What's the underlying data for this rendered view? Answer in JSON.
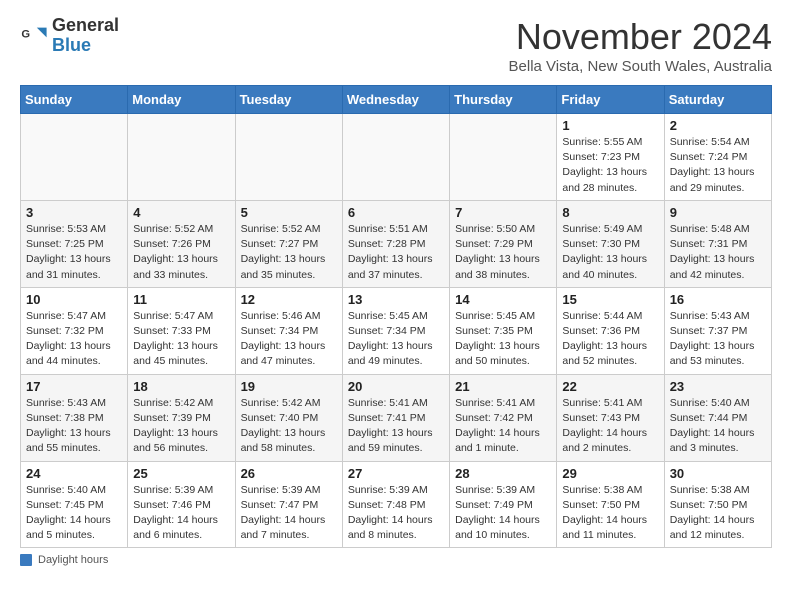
{
  "header": {
    "logo_general": "General",
    "logo_blue": "Blue",
    "month_title": "November 2024",
    "subtitle": "Bella Vista, New South Wales, Australia"
  },
  "days_of_week": [
    "Sunday",
    "Monday",
    "Tuesday",
    "Wednesday",
    "Thursday",
    "Friday",
    "Saturday"
  ],
  "weeks": [
    [
      {
        "day": "",
        "info": ""
      },
      {
        "day": "",
        "info": ""
      },
      {
        "day": "",
        "info": ""
      },
      {
        "day": "",
        "info": ""
      },
      {
        "day": "",
        "info": ""
      },
      {
        "day": "1",
        "info": "Sunrise: 5:55 AM\nSunset: 7:23 PM\nDaylight: 13 hours and 28 minutes."
      },
      {
        "day": "2",
        "info": "Sunrise: 5:54 AM\nSunset: 7:24 PM\nDaylight: 13 hours and 29 minutes."
      }
    ],
    [
      {
        "day": "3",
        "info": "Sunrise: 5:53 AM\nSunset: 7:25 PM\nDaylight: 13 hours and 31 minutes."
      },
      {
        "day": "4",
        "info": "Sunrise: 5:52 AM\nSunset: 7:26 PM\nDaylight: 13 hours and 33 minutes."
      },
      {
        "day": "5",
        "info": "Sunrise: 5:52 AM\nSunset: 7:27 PM\nDaylight: 13 hours and 35 minutes."
      },
      {
        "day": "6",
        "info": "Sunrise: 5:51 AM\nSunset: 7:28 PM\nDaylight: 13 hours and 37 minutes."
      },
      {
        "day": "7",
        "info": "Sunrise: 5:50 AM\nSunset: 7:29 PM\nDaylight: 13 hours and 38 minutes."
      },
      {
        "day": "8",
        "info": "Sunrise: 5:49 AM\nSunset: 7:30 PM\nDaylight: 13 hours and 40 minutes."
      },
      {
        "day": "9",
        "info": "Sunrise: 5:48 AM\nSunset: 7:31 PM\nDaylight: 13 hours and 42 minutes."
      }
    ],
    [
      {
        "day": "10",
        "info": "Sunrise: 5:47 AM\nSunset: 7:32 PM\nDaylight: 13 hours and 44 minutes."
      },
      {
        "day": "11",
        "info": "Sunrise: 5:47 AM\nSunset: 7:33 PM\nDaylight: 13 hours and 45 minutes."
      },
      {
        "day": "12",
        "info": "Sunrise: 5:46 AM\nSunset: 7:34 PM\nDaylight: 13 hours and 47 minutes."
      },
      {
        "day": "13",
        "info": "Sunrise: 5:45 AM\nSunset: 7:34 PM\nDaylight: 13 hours and 49 minutes."
      },
      {
        "day": "14",
        "info": "Sunrise: 5:45 AM\nSunset: 7:35 PM\nDaylight: 13 hours and 50 minutes."
      },
      {
        "day": "15",
        "info": "Sunrise: 5:44 AM\nSunset: 7:36 PM\nDaylight: 13 hours and 52 minutes."
      },
      {
        "day": "16",
        "info": "Sunrise: 5:43 AM\nSunset: 7:37 PM\nDaylight: 13 hours and 53 minutes."
      }
    ],
    [
      {
        "day": "17",
        "info": "Sunrise: 5:43 AM\nSunset: 7:38 PM\nDaylight: 13 hours and 55 minutes."
      },
      {
        "day": "18",
        "info": "Sunrise: 5:42 AM\nSunset: 7:39 PM\nDaylight: 13 hours and 56 minutes."
      },
      {
        "day": "19",
        "info": "Sunrise: 5:42 AM\nSunset: 7:40 PM\nDaylight: 13 hours and 58 minutes."
      },
      {
        "day": "20",
        "info": "Sunrise: 5:41 AM\nSunset: 7:41 PM\nDaylight: 13 hours and 59 minutes."
      },
      {
        "day": "21",
        "info": "Sunrise: 5:41 AM\nSunset: 7:42 PM\nDaylight: 14 hours and 1 minute."
      },
      {
        "day": "22",
        "info": "Sunrise: 5:41 AM\nSunset: 7:43 PM\nDaylight: 14 hours and 2 minutes."
      },
      {
        "day": "23",
        "info": "Sunrise: 5:40 AM\nSunset: 7:44 PM\nDaylight: 14 hours and 3 minutes."
      }
    ],
    [
      {
        "day": "24",
        "info": "Sunrise: 5:40 AM\nSunset: 7:45 PM\nDaylight: 14 hours and 5 minutes."
      },
      {
        "day": "25",
        "info": "Sunrise: 5:39 AM\nSunset: 7:46 PM\nDaylight: 14 hours and 6 minutes."
      },
      {
        "day": "26",
        "info": "Sunrise: 5:39 AM\nSunset: 7:47 PM\nDaylight: 14 hours and 7 minutes."
      },
      {
        "day": "27",
        "info": "Sunrise: 5:39 AM\nSunset: 7:48 PM\nDaylight: 14 hours and 8 minutes."
      },
      {
        "day": "28",
        "info": "Sunrise: 5:39 AM\nSunset: 7:49 PM\nDaylight: 14 hours and 10 minutes."
      },
      {
        "day": "29",
        "info": "Sunrise: 5:38 AM\nSunset: 7:50 PM\nDaylight: 14 hours and 11 minutes."
      },
      {
        "day": "30",
        "info": "Sunrise: 5:38 AM\nSunset: 7:50 PM\nDaylight: 14 hours and 12 minutes."
      }
    ]
  ],
  "footer": {
    "daylight_label": "Daylight hours"
  }
}
